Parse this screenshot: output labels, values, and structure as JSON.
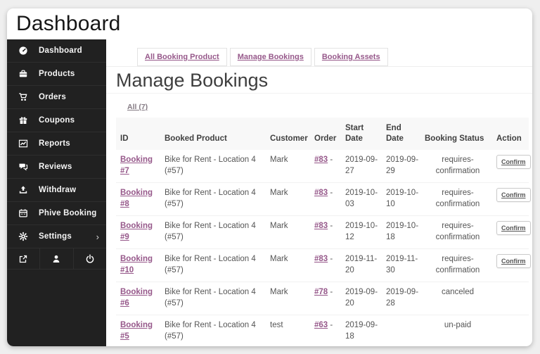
{
  "window": {
    "title": "Dashboard"
  },
  "colors": {
    "accent_purple": "#96588a",
    "sidebar_bg": "#212121",
    "card_bg": "#ffffff",
    "table_header_bg": "#f8f8f8"
  },
  "sidebar": {
    "items": [
      {
        "label": "Dashboard",
        "icon": "dashboard-gauge-icon"
      },
      {
        "label": "Products",
        "icon": "briefcase-icon"
      },
      {
        "label": "Orders",
        "icon": "cart-icon"
      },
      {
        "label": "Coupons",
        "icon": "gift-icon"
      },
      {
        "label": "Reports",
        "icon": "chart-icon"
      },
      {
        "label": "Reviews",
        "icon": "comments-icon"
      },
      {
        "label": "Withdraw",
        "icon": "upload-icon"
      },
      {
        "label": "Phive Booking",
        "icon": "calendar-icon"
      },
      {
        "label": "Settings",
        "icon": "gear-icon",
        "chevron": "›"
      }
    ],
    "footer_icons": [
      "external-link-icon",
      "user-icon",
      "power-icon"
    ]
  },
  "tabs": [
    {
      "label": "All Booking Product"
    },
    {
      "label": "Manage Bookings"
    },
    {
      "label": "Booking Assets"
    }
  ],
  "main": {
    "title": "Manage Bookings",
    "filter_label": "All (7)"
  },
  "table": {
    "columns": [
      "ID",
      "Booked Product",
      "Customer",
      "Order",
      "Start Date",
      "End Date",
      "Booking Status",
      "Action"
    ],
    "rows": [
      {
        "id": "Booking #7",
        "product": "Bike for Rent - Location 4 (#57)",
        "customer": "Mark",
        "order": "#83",
        "order_suffix": "-",
        "start": "2019-09-27",
        "end": "2019-09-29",
        "status": "requires-confirmation",
        "action": "Confirm"
      },
      {
        "id": "Booking #8",
        "product": "Bike for Rent - Location 4 (#57)",
        "customer": "Mark",
        "order": "#83",
        "order_suffix": "-",
        "start": "2019-10-03",
        "end": "2019-10-10",
        "status": "requires-confirmation",
        "action": "Confirm"
      },
      {
        "id": "Booking #9",
        "product": "Bike for Rent - Location 4 (#57)",
        "customer": "Mark",
        "order": "#83",
        "order_suffix": "-",
        "start": "2019-10-12",
        "end": "2019-10-18",
        "status": "requires-confirmation",
        "action": "Confirm"
      },
      {
        "id": "Booking #10",
        "product": "Bike for Rent - Location 4 (#57)",
        "customer": "Mark",
        "order": "#83",
        "order_suffix": "-",
        "start": "2019-11-20",
        "end": "2019-11-30",
        "status": "requires-confirmation",
        "action": "Confirm"
      },
      {
        "id": "Booking #6",
        "product": "Bike for Rent - Location 4 (#57)",
        "customer": "Mark",
        "order": "#78",
        "order_suffix": "-",
        "start": "2019-09-20",
        "end": "2019-09-28",
        "status": "canceled"
      },
      {
        "id": "Booking #5",
        "product": "Bike for Rent - Location 4 (#57)",
        "customer": "test",
        "order": "#63",
        "order_suffix": "-",
        "start": "2019-09-18",
        "end": "",
        "status": "un-paid"
      }
    ]
  }
}
